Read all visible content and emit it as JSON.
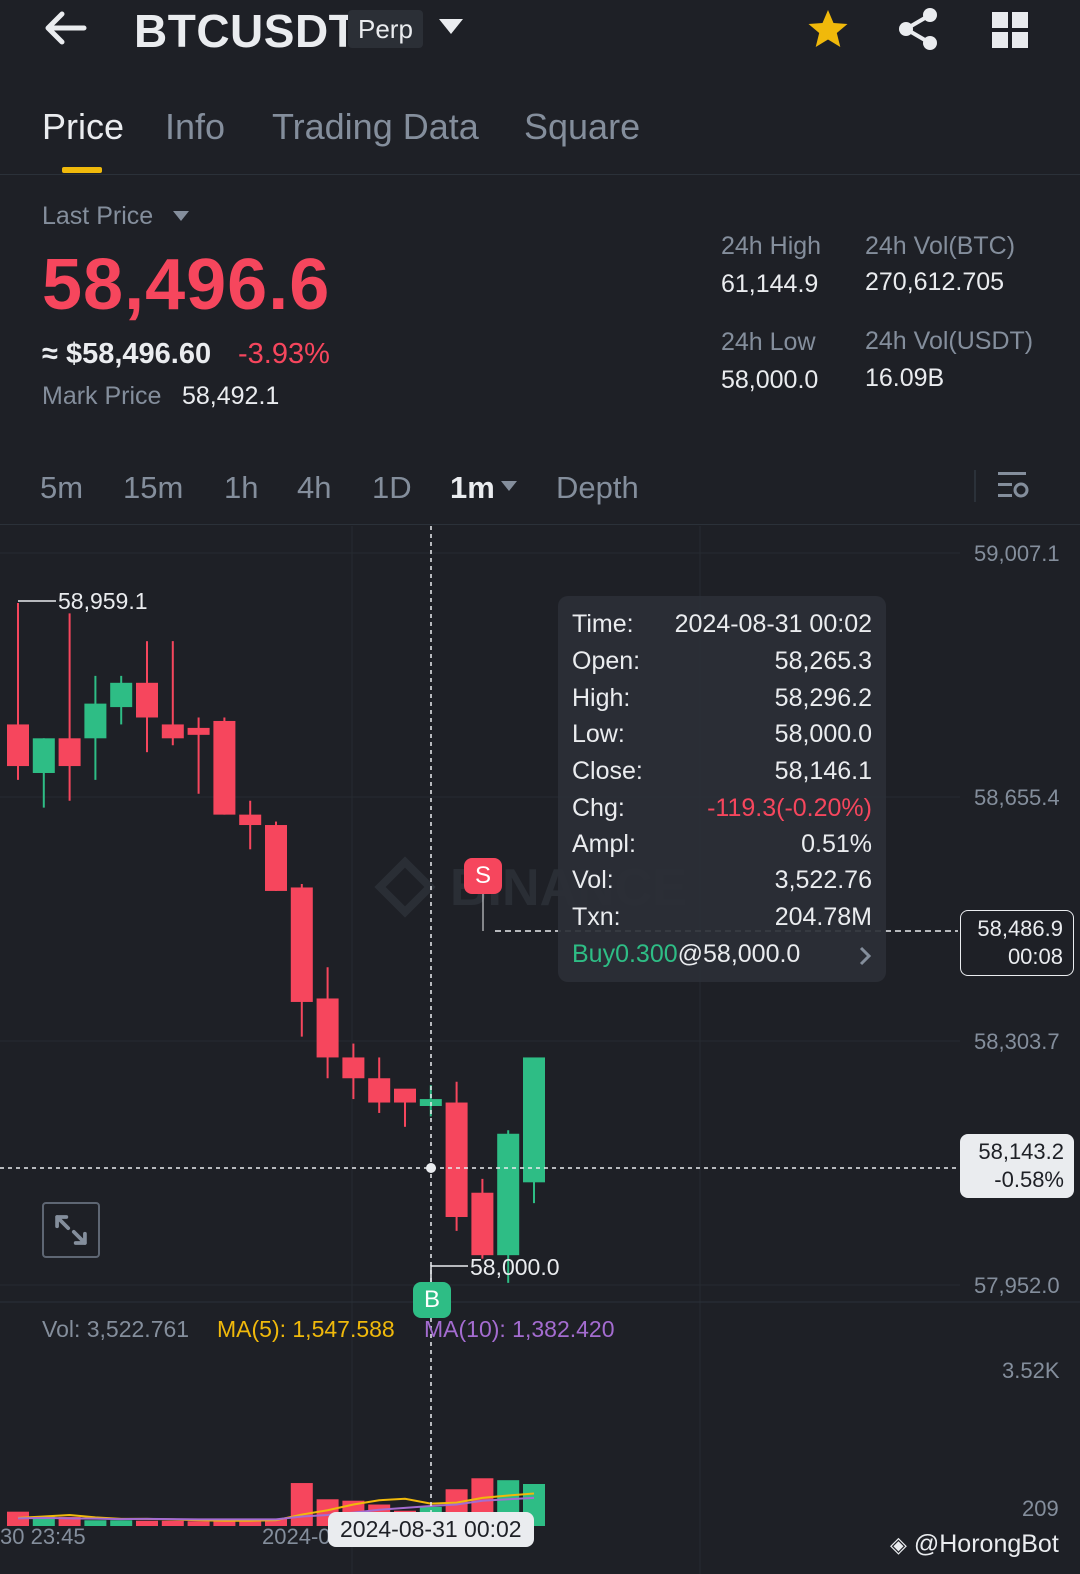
{
  "header": {
    "symbol": "BTCUSDT",
    "badge": "Perp",
    "icons": [
      "back-arrow-icon",
      "caret-down-icon",
      "star-icon",
      "share-icon",
      "grid-icon"
    ],
    "star_color": "#f0b90b"
  },
  "tabs": [
    {
      "label": "Price",
      "active": true
    },
    {
      "label": "Info",
      "active": false
    },
    {
      "label": "Trading Data",
      "active": false
    },
    {
      "label": "Square",
      "active": false
    }
  ],
  "price": {
    "last_price_label": "Last Price",
    "last_price": "58,496.6",
    "usd_equivalent": "≈ $58,496.60",
    "change_pct": "-3.93%",
    "mark_label": "Mark Price",
    "mark_value": "58,492.1"
  },
  "stats": {
    "high_label": "24h High",
    "high_value": "61,144.9",
    "low_label": "24h Low",
    "low_value": "58,000.0",
    "vol_btc_label": "24h Vol(BTC)",
    "vol_btc_value": "270,612.705",
    "vol_usdt_label": "24h Vol(USDT)",
    "vol_usdt_value": "16.09B"
  },
  "intervals": [
    {
      "label": "5m",
      "active": false
    },
    {
      "label": "15m",
      "active": false
    },
    {
      "label": "1h",
      "active": false
    },
    {
      "label": "4h",
      "active": false
    },
    {
      "label": "1D",
      "active": false
    },
    {
      "label": "1m",
      "active": true
    },
    {
      "label": "Depth",
      "active": false
    }
  ],
  "chart": {
    "price_axis": [
      "59,007.1",
      "58,655.4",
      "58,303.7",
      "57,952.0"
    ],
    "volume_axis": [
      "3.52K",
      "209"
    ],
    "high_marker": "58,959.1",
    "low_marker": "58,000.0",
    "sell_marker": "S",
    "buy_marker": "B",
    "last_price_tag": {
      "price": "58,486.9",
      "countdown": "00:08"
    },
    "crosshair_tag": {
      "price": "58,143.2",
      "change": "-0.58%"
    },
    "time_axis": [
      "30 23:45",
      "2024-0"
    ],
    "crosshair_time": "2024-08-31 00:02",
    "watermark": "BINANCE",
    "colors": {
      "up": "#2ebd85",
      "down": "#f6465d",
      "ma5": "#f0b90b",
      "ma10": "#a46cd0"
    }
  },
  "tooltip": {
    "rows": [
      {
        "k": "Time:",
        "v": "2024-08-31 00:02"
      },
      {
        "k": "Open:",
        "v": "58,265.3"
      },
      {
        "k": "High:",
        "v": "58,296.2"
      },
      {
        "k": "Low:",
        "v": "58,000.0"
      },
      {
        "k": "Close:",
        "v": "58,146.1"
      },
      {
        "k": "Chg:",
        "v": "-119.3(-0.20%)"
      },
      {
        "k": "Ampl:",
        "v": "0.51%"
      },
      {
        "k": "Vol:",
        "v": "3,522.76"
      },
      {
        "k": "Txn:",
        "v": "204.78M"
      }
    ],
    "trade_side": "Buy0.300",
    "trade_price": "@58,000.0"
  },
  "volume_legend": {
    "vol": "Vol: 3,522.761",
    "ma5": "MA(5): 1,547.588",
    "ma10": "MA(10): 1,382.420"
  },
  "chart_data": {
    "type": "candlestick",
    "interval": "1m",
    "candles": [
      {
        "o": 58760,
        "h": 58935,
        "c": 58700,
        "l": 58680
      },
      {
        "o": 58690,
        "h": 58740,
        "c": 58740,
        "l": 58640
      },
      {
        "o": 58740,
        "h": 58920,
        "c": 58700,
        "l": 58650
      },
      {
        "o": 58740,
        "h": 58830,
        "c": 58790,
        "l": 58680
      },
      {
        "o": 58785,
        "h": 58830,
        "c": 58820,
        "l": 58760
      },
      {
        "o": 58820,
        "h": 58880,
        "c": 58770,
        "l": 58720
      },
      {
        "o": 58760,
        "h": 58880,
        "c": 58740,
        "l": 58730
      },
      {
        "o": 58755,
        "h": 58770,
        "c": 58745,
        "l": 58660
      },
      {
        "o": 58765,
        "h": 58770,
        "c": 58630,
        "l": 58630
      },
      {
        "o": 58630,
        "h": 58650,
        "c": 58615,
        "l": 58580
      },
      {
        "o": 58615,
        "h": 58620,
        "c": 58520,
        "l": 58520
      },
      {
        "o": 58525,
        "h": 58530,
        "c": 58360,
        "l": 58310
      },
      {
        "o": 58365,
        "h": 58410,
        "c": 58280,
        "l": 58250
      },
      {
        "o": 58280,
        "h": 58300,
        "c": 58250,
        "l": 58220
      },
      {
        "o": 58250,
        "h": 58280,
        "c": 58215,
        "l": 58200
      },
      {
        "o": 58235,
        "h": 58225,
        "c": 58215,
        "l": 58180
      },
      {
        "o": 58210,
        "h": 58240,
        "c": 58220,
        "l": 58195
      },
      {
        "o": 58215,
        "h": 58245,
        "c": 58050,
        "l": 58030
      },
      {
        "o": 58085,
        "h": 58105,
        "c": 57995,
        "l": 57990
      },
      {
        "o": 57995,
        "h": 58175,
        "c": 58170,
        "l": 57955
      },
      {
        "o": 58100,
        "h": 58265,
        "c": 58280,
        "l": 58070
      }
    ],
    "volumes": [
      300,
      200,
      190,
      120,
      120,
      110,
      110,
      100,
      100,
      120,
      150,
      900,
      560,
      530,
      450,
      320,
      400,
      770,
      1000,
      960,
      880
    ],
    "ma5": [
      170,
      200,
      230,
      180,
      150,
      150,
      140,
      120,
      110,
      110,
      120,
      240,
      330,
      450,
      540,
      570,
      470,
      490,
      590,
      640,
      680
    ],
    "ma10": [
      160,
      170,
      160,
      155,
      145,
      150,
      145,
      140,
      140,
      140,
      140,
      200,
      230,
      280,
      340,
      380,
      420,
      450,
      530,
      560,
      590
    ],
    "y_range": [
      57952.0,
      59007.1
    ],
    "volume_range": [
      209,
      3520
    ]
  },
  "credit": "@HorongBot"
}
